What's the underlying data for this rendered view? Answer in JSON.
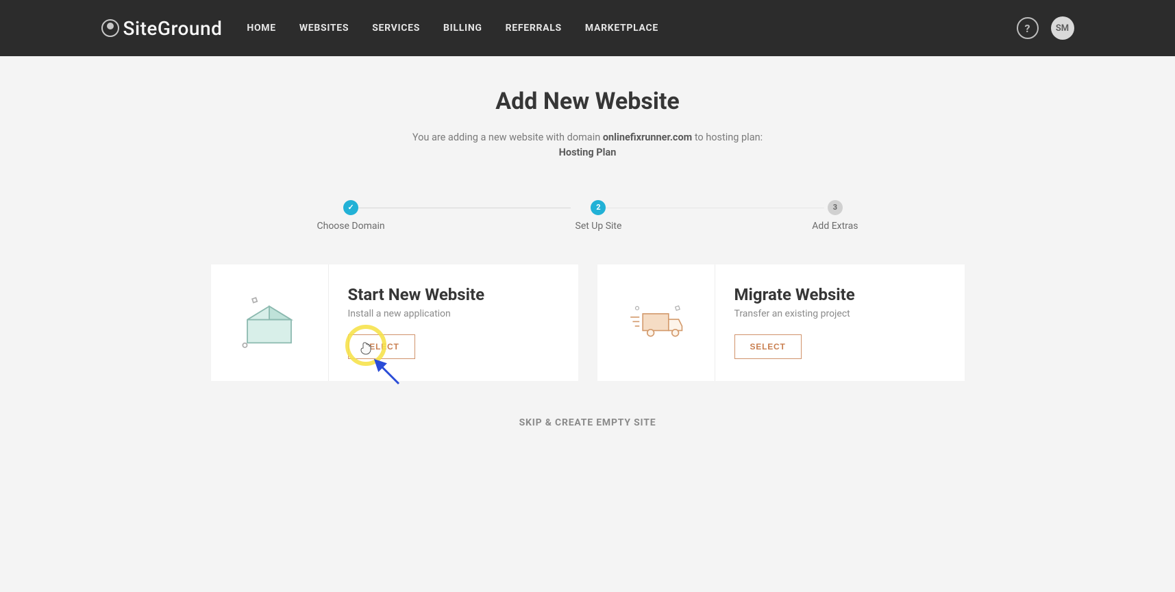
{
  "brand": "SiteGround",
  "nav": [
    "HOME",
    "WEBSITES",
    "SERVICES",
    "BILLING",
    "REFERRALS",
    "MARKETPLACE"
  ],
  "help_symbol": "?",
  "avatar_initials": "SM",
  "page_title": "Add New Website",
  "subtitle_prefix": "You are adding a new website with domain ",
  "subtitle_domain": "onlinefixrunner.com",
  "subtitle_mid": " to hosting plan:",
  "subtitle_plan": "Hosting Plan",
  "steps": [
    {
      "label": "Choose Domain",
      "state": "done",
      "mark": "✓"
    },
    {
      "label": "Set Up Site",
      "state": "active",
      "mark": "2"
    },
    {
      "label": "Add Extras",
      "state": "pending",
      "mark": "3"
    }
  ],
  "cards": [
    {
      "title": "Start New Website",
      "desc": "Install a new application",
      "button": "SELECT",
      "highlighted": true
    },
    {
      "title": "Migrate Website",
      "desc": "Transfer an existing project",
      "button": "SELECT",
      "highlighted": false
    }
  ],
  "skip_label": "SKIP & CREATE EMPTY SITE"
}
